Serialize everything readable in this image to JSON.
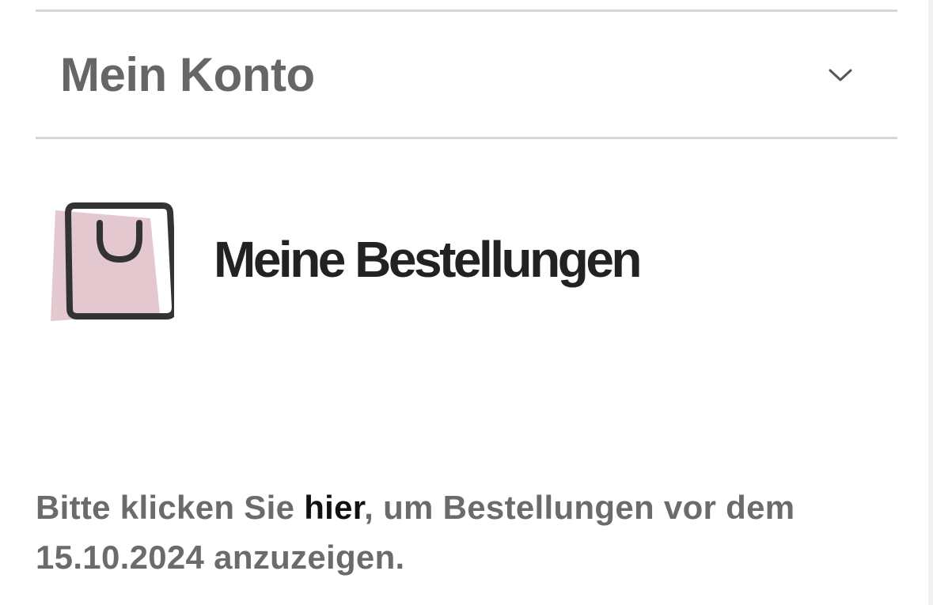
{
  "account": {
    "title": "Mein Konto",
    "toggle_icon": "chevron-down-icon"
  },
  "orders": {
    "icon": "shopping-bag-icon",
    "title": "Meine Bestellungen",
    "info_before_link": "Bitte klicken Sie ",
    "info_link": "hier",
    "info_after_link": ", um Bestellungen vor dem 15.10.2024 anzuzeigen."
  },
  "colors": {
    "bag_fill": "#e4c8d0",
    "bag_outline": "#333333",
    "divider": "#d6d6d6",
    "muted_text": "#666666",
    "dark_text": "#222222"
  }
}
